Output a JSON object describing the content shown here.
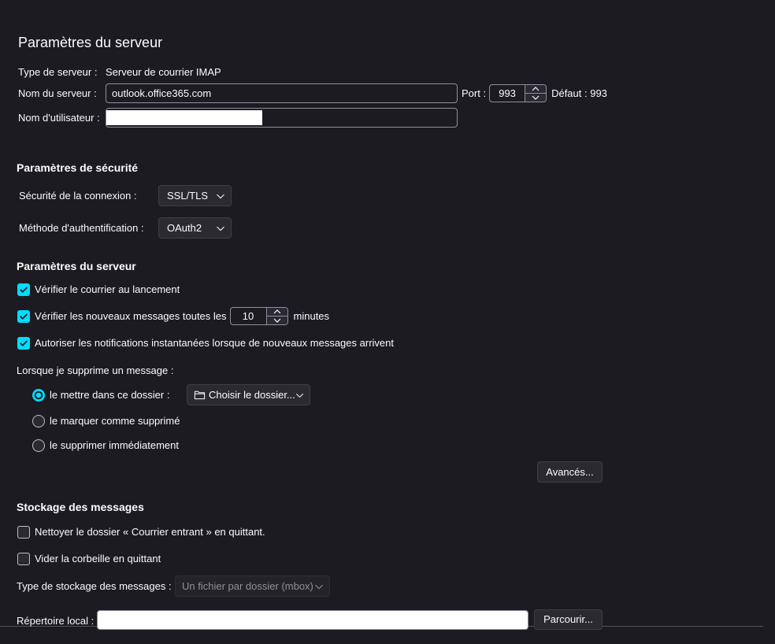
{
  "colors": {
    "background": "#1c1b22",
    "text": "#fbfbfe",
    "accent": "#00ddff",
    "control": "#2b2a33",
    "border": "#8f8f9d",
    "muted": "#8f8f9d",
    "redaction": "#ffffff"
  },
  "icons": {
    "dropdown_arrow": "chevron-down-icon",
    "spin_up": "chevron-up-icon",
    "spin_down": "chevron-down-icon",
    "check": "checkmark-icon",
    "folder": "folder-icon"
  },
  "page": {
    "title": "Paramètres du serveur"
  },
  "server": {
    "type_label": "Type de serveur :",
    "type_value": "Serveur de courrier IMAP",
    "name_label": "Nom du serveur :",
    "name_value": "outlook.office365.com",
    "port_label": "Port :",
    "port_value": "993",
    "default_port": "Défaut : 993",
    "username_label": "Nom d'utilisateur :"
  },
  "security": {
    "heading": "Paramètres de sécurité",
    "connection_label": "Sécurité de la connexion :",
    "connection_value": "SSL/TLS",
    "auth_label": "Méthode d'authentification :",
    "auth_value": "OAuth2"
  },
  "server_settings": {
    "heading": "Paramètres du serveur",
    "check_on_startup": {
      "label": "Vérifier le courrier au lancement",
      "checked": true
    },
    "check_interval": {
      "label": "Vérifier les nouveaux messages toutes les",
      "value": "10",
      "unit": "minutes",
      "checked": true
    },
    "push_notifications": {
      "label": "Autoriser les notifications instantanées lorsque de nouveaux messages arrivent",
      "checked": true
    },
    "delete_heading": "Lorsque je supprime un message :",
    "delete_options": [
      {
        "label": "le mettre dans ce dossier :",
        "selected": true
      },
      {
        "label": "le marquer comme supprimé",
        "selected": false
      },
      {
        "label": "le supprimer immédiatement",
        "selected": false
      }
    ],
    "folder_picker": "Choisir le dossier...",
    "advanced_button": "Avancés..."
  },
  "storage": {
    "heading": "Stockage des messages",
    "cleanup_inbox": {
      "label": "Nettoyer le dossier « Courrier entrant » en quittant.",
      "checked": false
    },
    "empty_trash": {
      "label": "Vider la corbeille en quittant",
      "checked": false
    },
    "store_type_label": "Type de stockage des messages :",
    "store_type_value": "Un fichier par dossier (mbox)",
    "store_type_disabled": true,
    "local_dir_label": "Répertoire local :",
    "browse_button": "Parcourir..."
  }
}
